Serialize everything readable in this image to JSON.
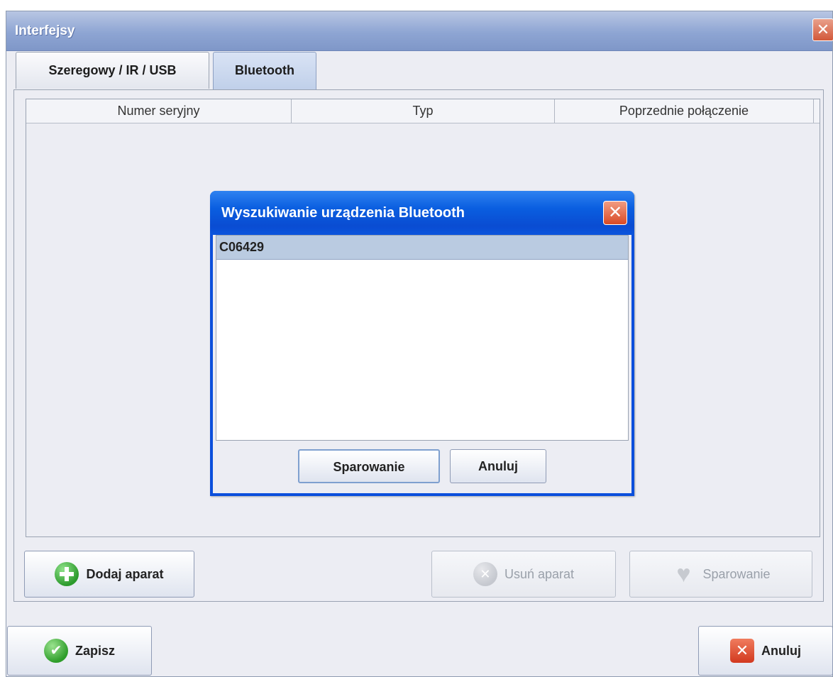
{
  "window": {
    "title": "Interfejsy",
    "close_glyph": "✕"
  },
  "tabs": [
    {
      "label": "Szeregowy / IR / USB",
      "selected": false
    },
    {
      "label": "Bluetooth",
      "selected": true
    }
  ],
  "table": {
    "columns": [
      "Numer seryjny",
      "Typ",
      "Poprzednie połączenie"
    ]
  },
  "buttons": {
    "add_device": "Dodaj aparat",
    "remove_device": "Usuń aparat",
    "pair": "Sparowanie",
    "save": "Zapisz",
    "cancel": "Anuluj"
  },
  "dialog": {
    "title": "Wyszukiwanie urządzenia Bluetooth",
    "close_glyph": "✕",
    "devices": [
      "C06429"
    ],
    "pair_label": "Sparowanie",
    "cancel_label": "Anuluj"
  },
  "icons": {
    "add": "plus-circle-icon",
    "remove": "remove-circle-icon",
    "pair": "heart-icon",
    "save": "check-circle-icon",
    "cancel": "x-square-icon"
  }
}
